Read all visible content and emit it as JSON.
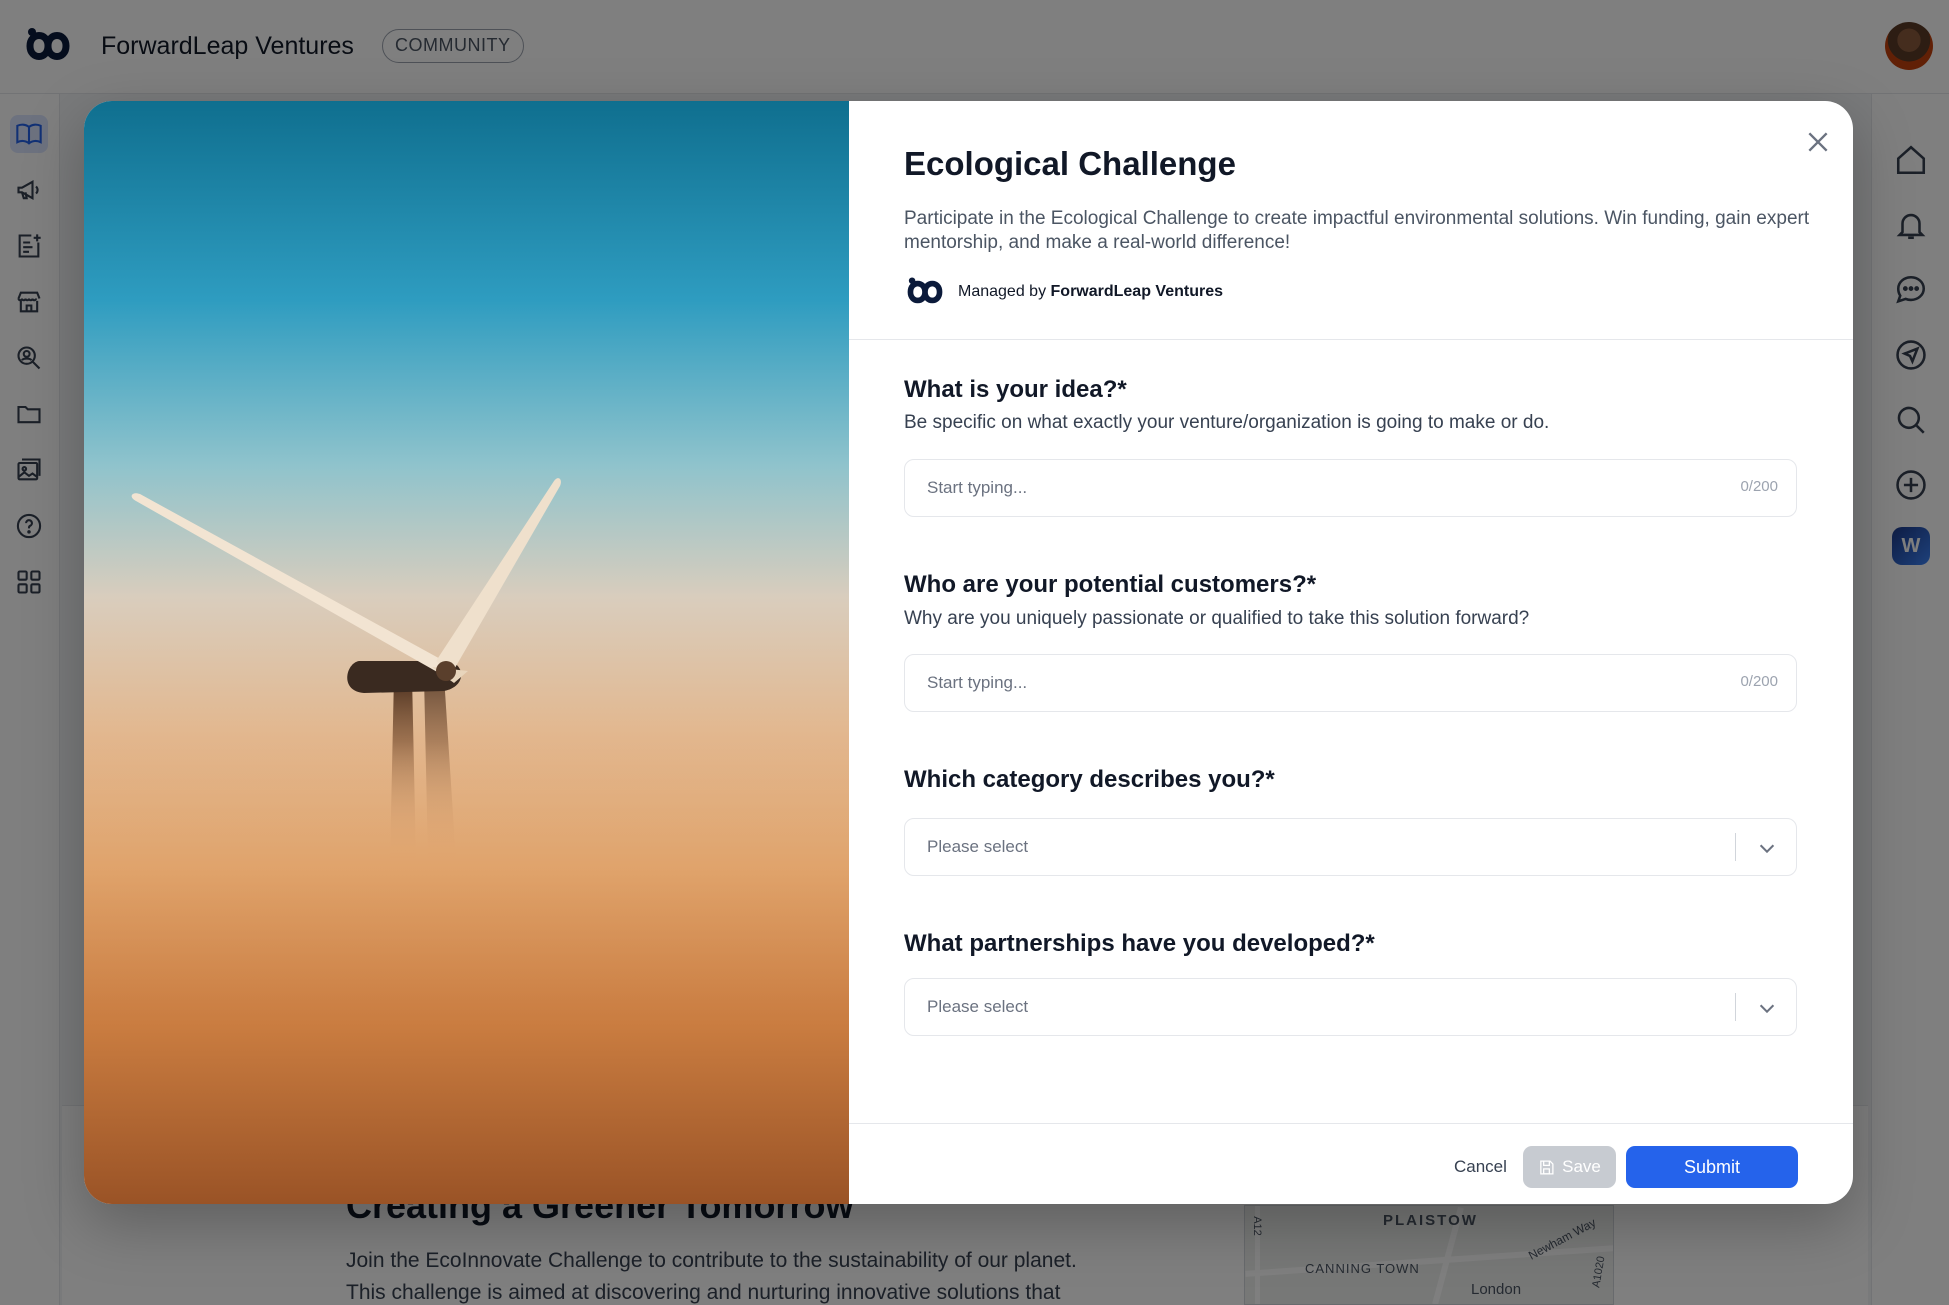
{
  "app": {
    "brand_name": "ForwardLeap Ventures",
    "badge": "COMMUNITY"
  },
  "left_nav": {
    "icons": [
      "book-icon",
      "megaphone-icon",
      "add-note-icon",
      "store-icon",
      "people-search-icon",
      "folder-icon",
      "gallery-icon",
      "help-icon",
      "grid-icon"
    ],
    "active": "book-icon"
  },
  "right_nav": {
    "icons": [
      "home-icon",
      "bell-icon",
      "chat-icon",
      "send-icon",
      "search-icon",
      "plus-circle-icon",
      "w-app-icon"
    ],
    "w_badge_letter": "W"
  },
  "background": {
    "title": "Creating a Greener Tomorrow",
    "text_line1": "Join the EcoInnovate Challenge to contribute to the sustainability of our planet.",
    "text_line2": "This challenge is aimed at discovering and nurturing innovative solutions that",
    "map_labels": [
      "PLAISTOW",
      "CANNING TOWN",
      "London",
      "Newham Way",
      "A12",
      "A1020"
    ]
  },
  "modal": {
    "title": "Ecological Challenge",
    "description": "Participate in the Ecological Challenge to create impactful environmental solutions. Win funding, gain expert mentorship, and make a real-world difference!",
    "managed_by_prefix": "Managed by ",
    "managed_by_org": "ForwardLeap Ventures",
    "questions": [
      {
        "title": "What is your idea?*",
        "help": "Be specific on what exactly your venture/organization is going to make or do.",
        "placeholder": "Start typing...",
        "counter": "0/200"
      },
      {
        "title": "Who are your potential customers?*",
        "help": "Why are you uniquely passionate or qualified to take this solution forward?",
        "placeholder": "Start typing...",
        "counter": "0/200"
      },
      {
        "title": "Which category describes you?*",
        "select": "Please select"
      },
      {
        "title": "What partnerships have you developed?*",
        "select": "Please select"
      }
    ],
    "footer": {
      "cancel": "Cancel",
      "save": "Save",
      "submit": "Submit"
    }
  },
  "colors": {
    "accent": "#2563eb",
    "overlay": "rgba(0,0,0,0.5)"
  }
}
